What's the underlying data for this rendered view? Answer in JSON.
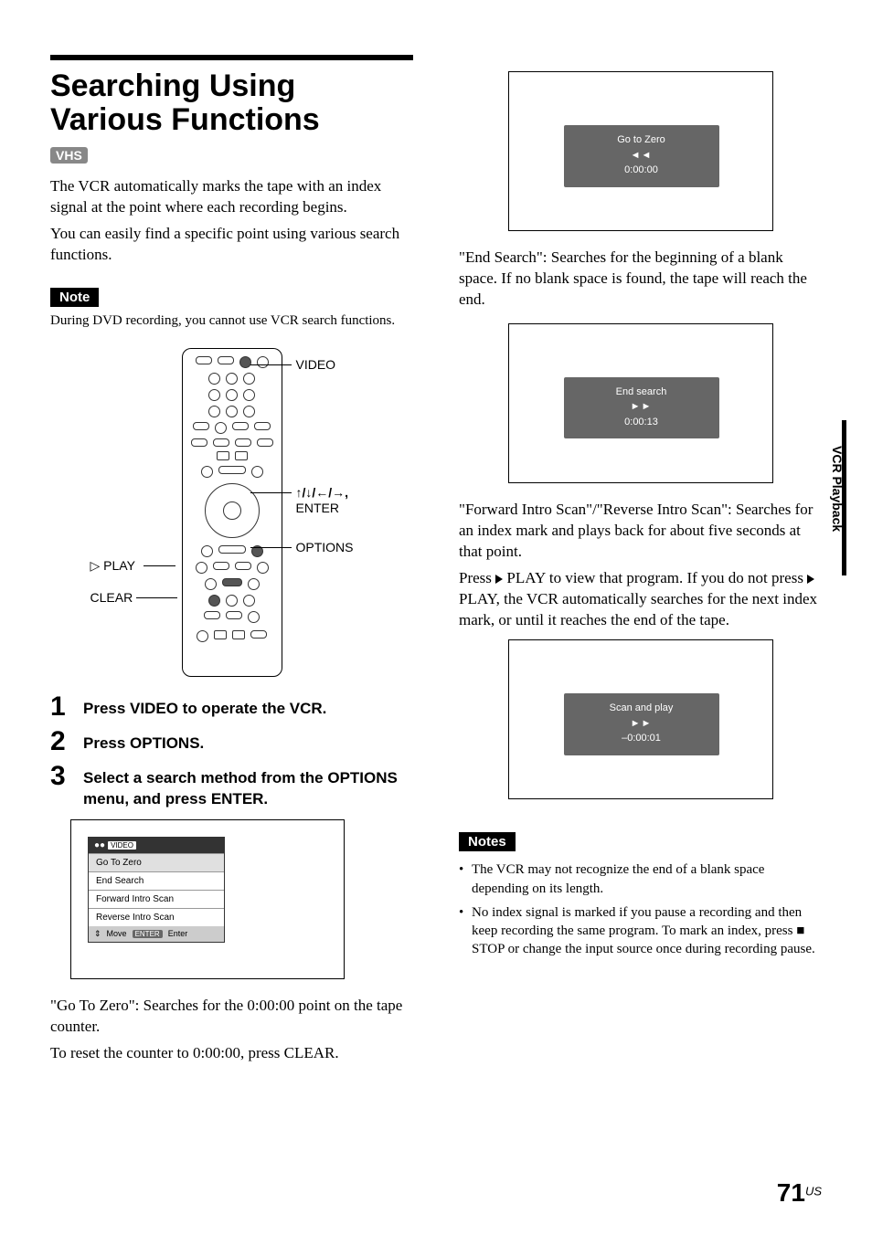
{
  "title": "Searching Using Various Functions",
  "vhs_badge": "VHS",
  "intro1": "The VCR automatically marks the tape with an index signal at the point where each recording begins.",
  "intro2": "You can easily find a specific point using various search functions.",
  "note_label": "Note",
  "note_text": "During DVD recording, you cannot use VCR search functions.",
  "remote_labels": {
    "video": "VIDEO",
    "arrows": "↑/↓/←/→,",
    "enter": "ENTER",
    "options": "OPTIONS",
    "play": "▷ PLAY",
    "clear": "CLEAR"
  },
  "steps": [
    {
      "n": "1",
      "t": "Press VIDEO to operate the VCR."
    },
    {
      "n": "2",
      "t": "Press OPTIONS."
    },
    {
      "n": "3",
      "t": "Select a search method from the OPTIONS menu, and press ENTER."
    }
  ],
  "options_menu": {
    "header_icon": "●●",
    "header_label": "VIDEO",
    "items": [
      "Go To Zero",
      "End Search",
      "Forward Intro Scan",
      "Reverse Intro Scan"
    ],
    "footer_move": "Move",
    "footer_enter_badge": "ENTER",
    "footer_enter": "Enter"
  },
  "go_to_zero_desc1": "\"Go To Zero\": Searches for the 0:00:00 point on the tape counter.",
  "go_to_zero_desc2": "To reset the counter to 0:00:00, press CLEAR.",
  "osd1": {
    "title": "Go to Zero",
    "arrows": "◄◄",
    "time": "0:00:00"
  },
  "end_search_desc": "\"End Search\": Searches for the beginning of a blank space. If no blank space is found, the tape will reach the end.",
  "osd2": {
    "title": "End search",
    "arrows": "►►",
    "time": "0:00:13"
  },
  "intro_scan_desc1": "\"Forward Intro Scan\"/\"Reverse Intro Scan\": Searches for an index mark and plays back for about five seconds at that point.",
  "intro_scan_desc2a": "Press ",
  "intro_scan_desc2b": " PLAY to view that program. If you do not press ",
  "intro_scan_desc2c": " PLAY, the VCR automatically searches for the next index mark, or until it reaches the end of the tape.",
  "osd3": {
    "title": "Scan and play",
    "arrows": "►►",
    "time": "–0:00:01"
  },
  "notes_label": "Notes",
  "notes": [
    "The VCR may not recognize the end of a blank space depending on its length.",
    "No index signal is marked if you pause a recording and then keep recording the same program. To mark an index, press ■ STOP or change the input source once during recording pause."
  ],
  "side_tab": "VCR Playback",
  "page_number": "71",
  "page_region": "US"
}
